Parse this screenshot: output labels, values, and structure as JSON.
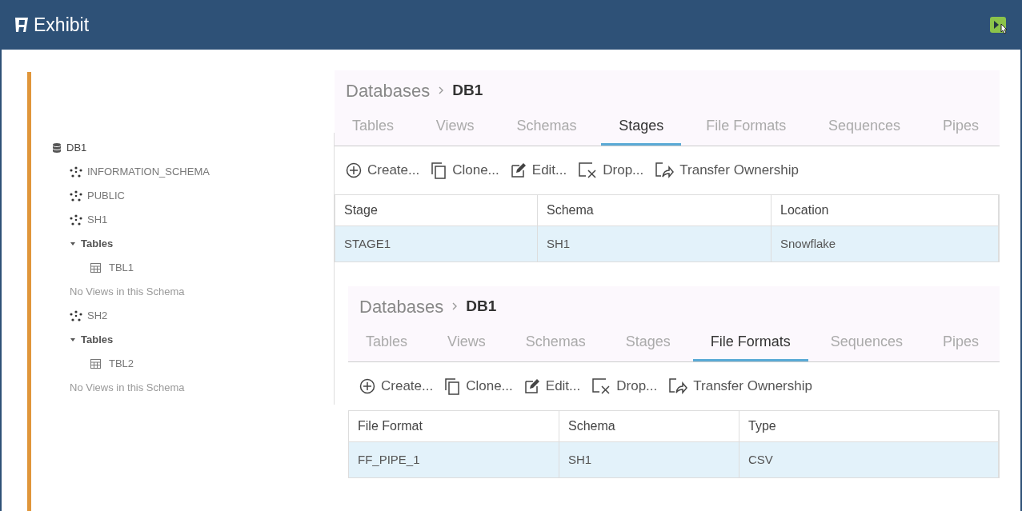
{
  "window": {
    "title": "Exhibit"
  },
  "tree": [
    {
      "kind": "database",
      "label": "DB1",
      "children": [
        {
          "kind": "schema",
          "label": "INFORMATION_SCHEMA"
        },
        {
          "kind": "schema",
          "label": "PUBLIC"
        },
        {
          "kind": "schema",
          "label": "SH1"
        },
        {
          "kind": "folder",
          "label": "Tables",
          "expanded": true,
          "children": [
            {
              "kind": "table",
              "label": "TBL1"
            }
          ]
        },
        {
          "kind": "note",
          "label": "No Views in this Schema"
        },
        {
          "kind": "schema",
          "label": "SH2"
        },
        {
          "kind": "folder",
          "label": "Tables",
          "expanded": true,
          "children": [
            {
              "kind": "table",
              "label": "TBL2"
            }
          ]
        },
        {
          "kind": "note",
          "label": "No Views in this Schema"
        }
      ]
    }
  ],
  "panels": [
    {
      "breadcrumb": [
        "Databases",
        "DB1"
      ],
      "tabs": [
        {
          "label": "Tables",
          "selected": false
        },
        {
          "label": "Views",
          "selected": false
        },
        {
          "label": "Schemas",
          "selected": false
        },
        {
          "label": "Stages",
          "selected": true
        },
        {
          "label": "File Formats",
          "selected": false
        },
        {
          "label": "Sequences",
          "selected": false
        },
        {
          "label": "Pipes",
          "selected": false
        }
      ],
      "actions": [
        {
          "kind": "create",
          "label": "Create..."
        },
        {
          "kind": "clone",
          "label": "Clone..."
        },
        {
          "kind": "edit",
          "label": "Edit..."
        },
        {
          "kind": "drop",
          "label": "Drop..."
        },
        {
          "kind": "transfer",
          "label": "Transfer Ownership"
        }
      ],
      "table": {
        "columns": [
          "Stage",
          "Schema",
          "Location"
        ],
        "rows": [
          [
            "STAGE1",
            "SH1",
            "Snowflake"
          ]
        ]
      }
    },
    {
      "breadcrumb": [
        "Databases",
        "DB1"
      ],
      "tabs": [
        {
          "label": "Tables",
          "selected": false
        },
        {
          "label": "Views",
          "selected": false
        },
        {
          "label": "Schemas",
          "selected": false
        },
        {
          "label": "Stages",
          "selected": false
        },
        {
          "label": "File Formats",
          "selected": true
        },
        {
          "label": "Sequences",
          "selected": false
        },
        {
          "label": "Pipes",
          "selected": false
        }
      ],
      "actions": [
        {
          "kind": "create",
          "label": "Create..."
        },
        {
          "kind": "clone",
          "label": "Clone..."
        },
        {
          "kind": "edit",
          "label": "Edit..."
        },
        {
          "kind": "drop",
          "label": "Drop..."
        },
        {
          "kind": "transfer",
          "label": "Transfer Ownership"
        }
      ],
      "table": {
        "columns": [
          "File Format",
          "Schema",
          "Type"
        ],
        "rows": [
          [
            "FF_PIPE_1",
            "SH1",
            "CSV"
          ]
        ]
      }
    }
  ]
}
